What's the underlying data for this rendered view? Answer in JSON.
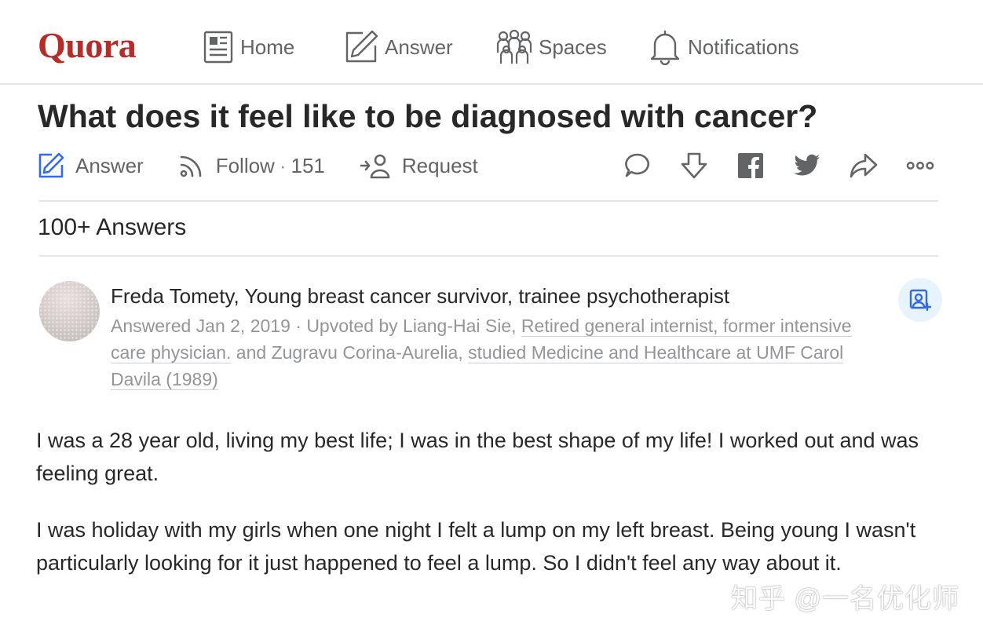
{
  "brand": {
    "logo_text": "Quora",
    "color": "#b92b27"
  },
  "nav": {
    "home_label": "Home",
    "answer_label": "Answer",
    "spaces_label": "Spaces",
    "notifications_label": "Notifications"
  },
  "question": {
    "title": "What does it feel like to be diagnosed with cancer?",
    "answer_label": "Answer",
    "follow_label": "Follow",
    "follow_separator": "·",
    "follow_count": "151",
    "request_label": "Request",
    "right_icons": [
      "comment-icon",
      "downvote-icon",
      "facebook-icon",
      "twitter-icon",
      "share-icon",
      "more-icon"
    ]
  },
  "answers": {
    "count_label": "100+ Answers",
    "first": {
      "author_line": "Freda Tomety, Young breast cancer survivor, trainee psychotherapist",
      "answered_prefix": "Answered Jan 2, 2019 · Upvoted by Liang-Hai Sie, ",
      "upvoter1_credential": "Retired general internist, former intensive care physician.",
      "and_text": " and Zugravu Corina-Aurelia, ",
      "upvoter2_credential": "studied Medicine and Healthcare at UMF Carol Davila (1989)",
      "paragraphs": [
        "I was a 28 year old, living my best life; I was in the best shape of my life! I worked out and was feeling great.",
        "I was holiday with my girls when one night I felt a lump on my left breast. Being young I wasn't particularly looking for it just happened to feel a lump. So I didn't feel any way about it."
      ]
    }
  },
  "watermark": "知乎 @一名优化师",
  "colors": {
    "accent_blue": "#2e69ff",
    "text": "#282829",
    "muted": "#939598",
    "icon": "#636466"
  }
}
